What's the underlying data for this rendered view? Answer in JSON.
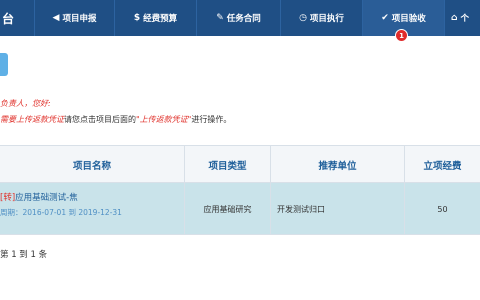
{
  "nav": {
    "brand": "台",
    "items": [
      {
        "icon": "◀",
        "label": "项目申报"
      },
      {
        "icon": "$",
        "label": "经费预算"
      },
      {
        "icon": "✎",
        "label": "任务合同"
      },
      {
        "icon": "◷",
        "label": "项目执行"
      },
      {
        "icon": "✔",
        "label": "项目验收"
      },
      {
        "icon": "⌂",
        "label": "个"
      }
    ],
    "badge": "1"
  },
  "notice": {
    "line1": "负责人，您好:",
    "line2_red": "需要上传返款凭证",
    "line2_mid": "请您点击项目后面的",
    "line2_quote": "\"上传返款凭证\"",
    "line2_end": "进行操作。"
  },
  "table": {
    "headers": [
      "项目名称",
      "项目类型",
      "推荐单位",
      "立项经费"
    ],
    "rows": [
      {
        "tag": "[转]",
        "name": "应用基础测试-焦",
        "period": "周期：2016-07-01 到 2019-12-31",
        "type": "应用基础研究",
        "unit": "开发测试归口",
        "funding": "50"
      }
    ]
  },
  "pager": "第 1 到 1 条"
}
